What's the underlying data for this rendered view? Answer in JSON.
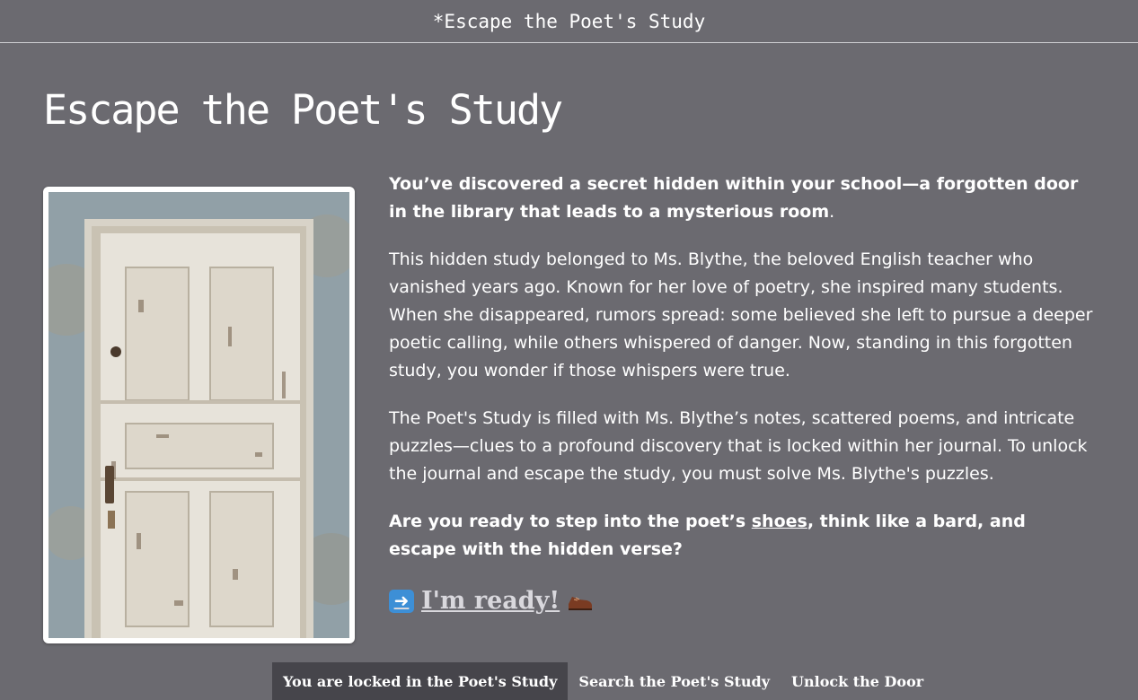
{
  "window": {
    "title": "*Escape the Poet's Study"
  },
  "page": {
    "title": "Escape the Poet's Study"
  },
  "intro": {
    "p1_bold": "You’ve discovered a secret hidden within your school—a forgotten door in the library that leads to a mysterious room",
    "p1_end": ".",
    "p2": "This hidden study belonged to Ms. Blythe, the beloved English teacher who vanished years ago. Known for her love of poetry, she inspired many students. When she disappeared, rumors spread: some believed she left to pursue a deeper poetic calling, while others whispered of danger. Now, standing in this forgotten study, you wonder if those whispers were true.",
    "p3": "The Poet's Study is filled with Ms. Blythe’s notes, scattered poems, and intricate puzzles—clues to a profound discovery that is locked within her journal. To unlock the journal and escape the study, you must solve Ms. Blythe's puzzles.",
    "p4_before": "Are you ready to step into the poet’s ",
    "p4_link": "shoes",
    "p4_after": ", think like a bard, and escape with the hidden verse?"
  },
  "cta": {
    "arrow_icon": "right-arrow-icon",
    "label": "I'm ready!",
    "shoe_icon": "shoe-icon"
  },
  "image": {
    "subject": "door-image"
  },
  "nav": {
    "items": [
      {
        "label": "You are locked in the Poet's Study",
        "active": true
      },
      {
        "label": "Search the Poet's Study",
        "active": false
      },
      {
        "label": "Unlock the Door",
        "active": false
      }
    ]
  },
  "colors": {
    "background": "#6b6a70",
    "nav_active": "#46454b",
    "link": "#d9d8dd"
  }
}
